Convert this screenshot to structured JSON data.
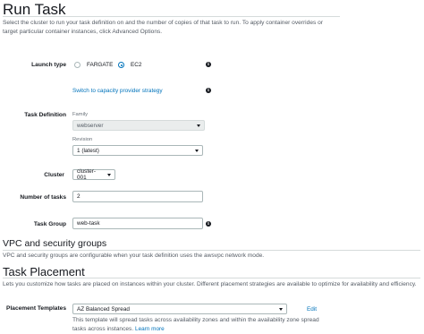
{
  "page": {
    "title": "Run Task",
    "description": "Select the cluster to run your task definition on and the number of copies of that task to run. To apply container overrides or target particular container instances, click Advanced Options."
  },
  "launch_type": {
    "label": "Launch type",
    "options": [
      "FARGATE",
      "EC2"
    ],
    "selected": "EC2"
  },
  "capacity_link": "Switch to capacity provider strategy",
  "task_definition": {
    "label": "Task Definition",
    "family_label": "Family",
    "family_value": "webserver",
    "revision_label": "Revision",
    "revision_value": "1 (latest)"
  },
  "cluster": {
    "label": "Cluster",
    "value": "cluster-001"
  },
  "num_tasks": {
    "label": "Number of tasks",
    "value": "2"
  },
  "task_group": {
    "label": "Task Group",
    "value": "web-task"
  },
  "vpc": {
    "title": "VPC and security groups",
    "description": "VPC and security groups are configurable when your task definition uses the awsvpc network mode."
  },
  "placement": {
    "title": "Task Placement",
    "description": "Lets you customize how tasks are placed on instances within your cluster. Different placement strategies are available to optimize for availability and efficiency.",
    "templates_label": "Placement Templates",
    "template_value": "AZ Balanced Spread",
    "edit_label": "Edit",
    "help_text_1": "This template will spread tasks across availability zones and within the availability zone spread",
    "help_text_2": "tasks across instances.",
    "learn_more": "Learn more"
  },
  "colors": {
    "link": "#0073bb",
    "text": "#16191f",
    "muted": "#545b64"
  },
  "icons": [
    "info-icon",
    "caret-down-icon"
  ]
}
